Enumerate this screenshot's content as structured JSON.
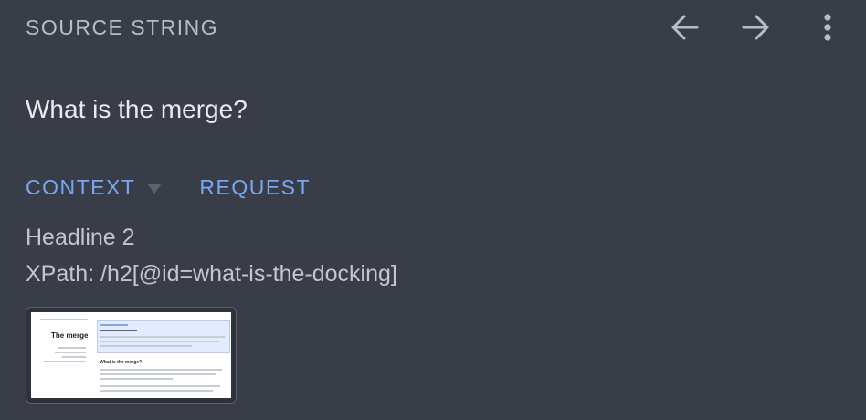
{
  "header": {
    "title": "SOURCE STRING",
    "back_icon": "arrow-left-icon",
    "forward_icon": "arrow-right-icon",
    "more_icon": "more-vertical-icon"
  },
  "source": {
    "text": "What is the merge?"
  },
  "tabs": [
    {
      "label": "CONTEXT",
      "has_dropdown": true
    },
    {
      "label": "REQUEST",
      "has_dropdown": false
    }
  ],
  "context": {
    "element_type": "Headline 2",
    "xpath": "XPath: /h2[@id=what-is-the-docking]"
  },
  "screenshot_preview": {
    "page_title": "The merge",
    "section_heading": "What is the merge?"
  },
  "colors": {
    "background": "#393d48",
    "accent": "#79a7f5",
    "text_primary": "#e9ebee",
    "text_secondary": "#c3c6cc"
  }
}
